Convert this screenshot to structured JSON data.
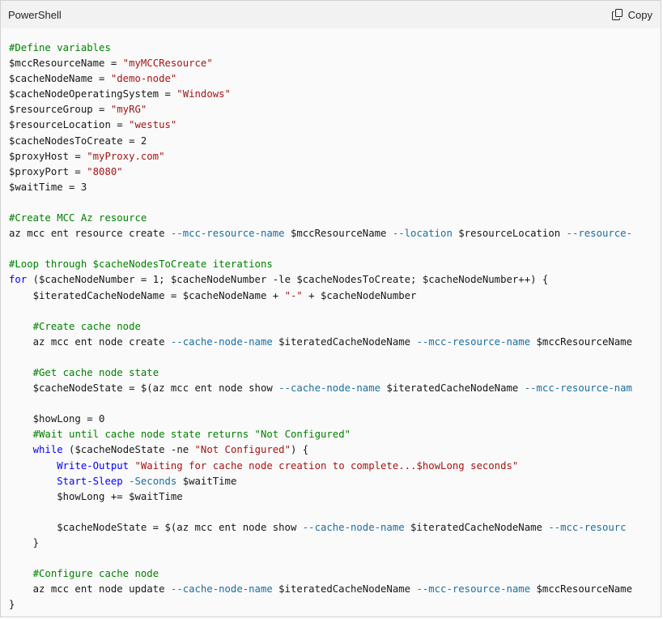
{
  "header": {
    "language": "PowerShell",
    "copy_label": "Copy",
    "copy_icon": "copy-icon"
  },
  "colors": {
    "comment": "#008000",
    "string": "#a31515",
    "keyword": "#0000ff",
    "parameter": "#1b6e9e",
    "text": "#171717",
    "header_bg": "#f2f2f2",
    "code_bg": "#fafafa"
  },
  "code_lines": [
    [
      {
        "t": "comment",
        "v": "#Define variables"
      }
    ],
    [
      {
        "t": "plain",
        "v": "$mccResourceName = "
      },
      {
        "t": "string",
        "v": "\"myMCCResource\""
      }
    ],
    [
      {
        "t": "plain",
        "v": "$cacheNodeName = "
      },
      {
        "t": "string",
        "v": "\"demo-node\""
      }
    ],
    [
      {
        "t": "plain",
        "v": "$cacheNodeOperatingSystem = "
      },
      {
        "t": "string",
        "v": "\"Windows\""
      }
    ],
    [
      {
        "t": "plain",
        "v": "$resourceGroup = "
      },
      {
        "t": "string",
        "v": "\"myRG\""
      }
    ],
    [
      {
        "t": "plain",
        "v": "$resourceLocation = "
      },
      {
        "t": "string",
        "v": "\"westus\""
      }
    ],
    [
      {
        "t": "plain",
        "v": "$cacheNodesToCreate = 2"
      }
    ],
    [
      {
        "t": "plain",
        "v": "$proxyHost = "
      },
      {
        "t": "string",
        "v": "\"myProxy.com\""
      }
    ],
    [
      {
        "t": "plain",
        "v": "$proxyPort = "
      },
      {
        "t": "string",
        "v": "\"8080\""
      }
    ],
    [
      {
        "t": "plain",
        "v": "$waitTime = 3"
      }
    ],
    [],
    [
      {
        "t": "comment",
        "v": "#Create MCC Az resource"
      }
    ],
    [
      {
        "t": "plain",
        "v": "az mcc ent resource create "
      },
      {
        "t": "param",
        "v": "--mcc-resource-name"
      },
      {
        "t": "plain",
        "v": " $mccResourceName "
      },
      {
        "t": "param",
        "v": "--location"
      },
      {
        "t": "plain",
        "v": " $resourceLocation "
      },
      {
        "t": "param",
        "v": "--resource-"
      }
    ],
    [],
    [
      {
        "t": "comment",
        "v": "#Loop through $cacheNodesToCreate iterations"
      }
    ],
    [
      {
        "t": "keyword",
        "v": "for"
      },
      {
        "t": "plain",
        "v": " ($cacheNodeNumber = 1; $cacheNodeNumber -le $cacheNodesToCreate; $cacheNodeNumber++) {"
      }
    ],
    [
      {
        "t": "plain",
        "v": "    $iteratedCacheNodeName = $cacheNodeName + "
      },
      {
        "t": "string",
        "v": "\"-\""
      },
      {
        "t": "plain",
        "v": " + $cacheNodeNumber"
      }
    ],
    [],
    [
      {
        "t": "plain",
        "v": "    "
      },
      {
        "t": "comment",
        "v": "#Create cache node"
      }
    ],
    [
      {
        "t": "plain",
        "v": "    az mcc ent node create "
      },
      {
        "t": "param",
        "v": "--cache-node-name"
      },
      {
        "t": "plain",
        "v": " $iteratedCacheNodeName "
      },
      {
        "t": "param",
        "v": "--mcc-resource-name"
      },
      {
        "t": "plain",
        "v": " $mccResourceName"
      }
    ],
    [],
    [
      {
        "t": "plain",
        "v": "    "
      },
      {
        "t": "comment",
        "v": "#Get cache node state"
      }
    ],
    [
      {
        "t": "plain",
        "v": "    $cacheNodeState = $(az mcc ent node show "
      },
      {
        "t": "param",
        "v": "--cache-node-name"
      },
      {
        "t": "plain",
        "v": " $iteratedCacheNodeName "
      },
      {
        "t": "param",
        "v": "--mcc-resource-nam"
      }
    ],
    [],
    [
      {
        "t": "plain",
        "v": "    $howLong = 0"
      }
    ],
    [
      {
        "t": "plain",
        "v": "    "
      },
      {
        "t": "comment",
        "v": "#Wait until cache node state returns \"Not Configured\""
      }
    ],
    [
      {
        "t": "plain",
        "v": "    "
      },
      {
        "t": "keyword",
        "v": "while"
      },
      {
        "t": "plain",
        "v": " ($cacheNodeState -ne "
      },
      {
        "t": "string",
        "v": "\"Not Configured\""
      },
      {
        "t": "plain",
        "v": ") {"
      }
    ],
    [
      {
        "t": "plain",
        "v": "        "
      },
      {
        "t": "keyword",
        "v": "Write-Output"
      },
      {
        "t": "plain",
        "v": " "
      },
      {
        "t": "string",
        "v": "\"Waiting for cache node creation to complete...$howLong seconds\""
      }
    ],
    [
      {
        "t": "plain",
        "v": "        "
      },
      {
        "t": "keyword",
        "v": "Start-Sleep"
      },
      {
        "t": "plain",
        "v": " "
      },
      {
        "t": "param",
        "v": "-Seconds"
      },
      {
        "t": "plain",
        "v": " $waitTime"
      }
    ],
    [
      {
        "t": "plain",
        "v": "        $howLong += $waitTime"
      }
    ],
    [],
    [
      {
        "t": "plain",
        "v": "        $cacheNodeState = $(az mcc ent node show "
      },
      {
        "t": "param",
        "v": "--cache-node-name"
      },
      {
        "t": "plain",
        "v": " $iteratedCacheNodeName "
      },
      {
        "t": "param",
        "v": "--mcc-resourc"
      }
    ],
    [
      {
        "t": "plain",
        "v": "    }"
      }
    ],
    [],
    [
      {
        "t": "plain",
        "v": "    "
      },
      {
        "t": "comment",
        "v": "#Configure cache node"
      }
    ],
    [
      {
        "t": "plain",
        "v": "    az mcc ent node update "
      },
      {
        "t": "param",
        "v": "--cache-node-name"
      },
      {
        "t": "plain",
        "v": " $iteratedCacheNodeName "
      },
      {
        "t": "param",
        "v": "--mcc-resource-name"
      },
      {
        "t": "plain",
        "v": " $mccResourceName"
      }
    ],
    [
      {
        "t": "plain",
        "v": "}"
      }
    ]
  ]
}
